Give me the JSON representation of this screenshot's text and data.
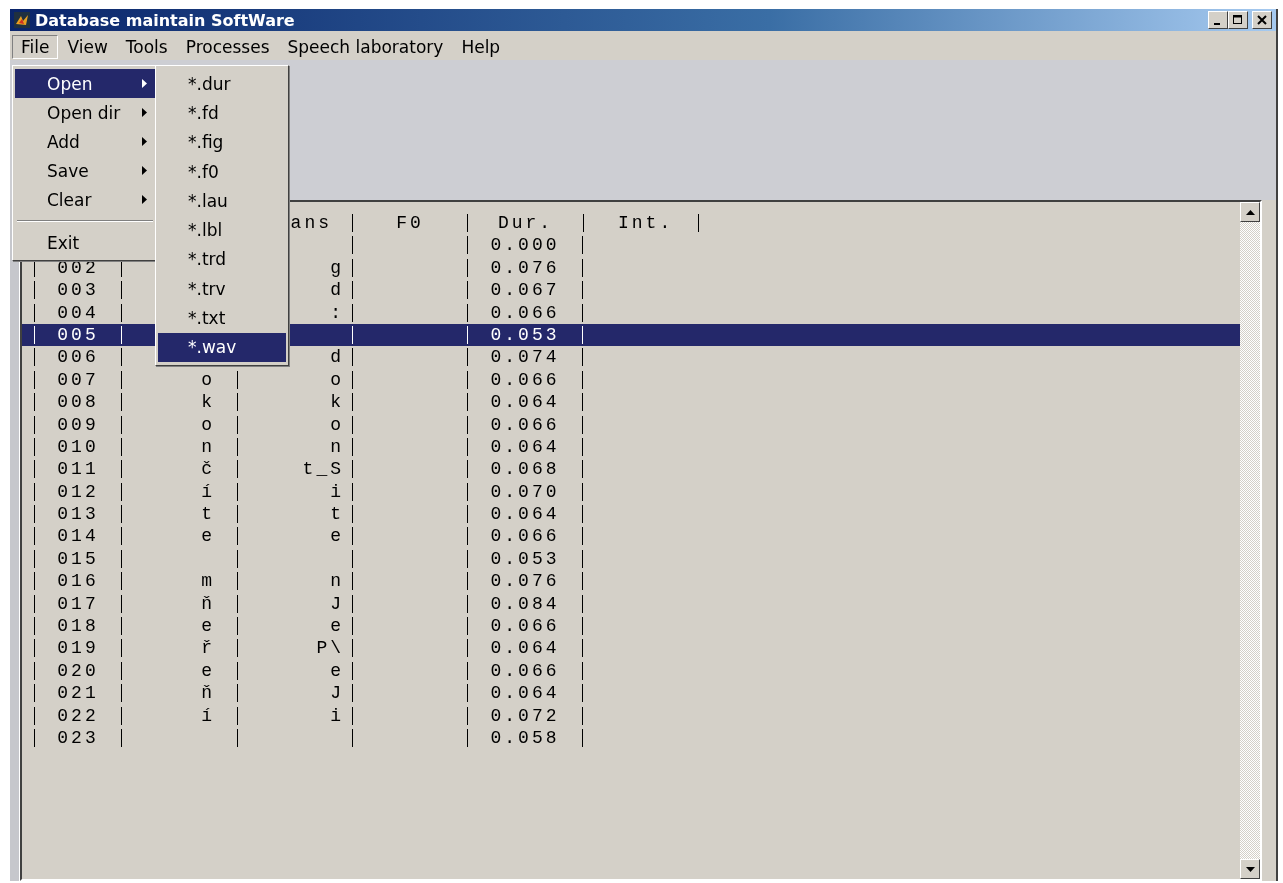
{
  "window": {
    "title": "Database maintain SoftWare"
  },
  "menu_bar": [
    {
      "label": "File",
      "selected": true
    },
    {
      "label": "View",
      "selected": false
    },
    {
      "label": "Tools",
      "selected": false
    },
    {
      "label": "Processes",
      "selected": false
    },
    {
      "label": "Speech laboratory",
      "selected": false
    },
    {
      "label": "Help",
      "selected": false
    }
  ],
  "file_menu": [
    {
      "kind": "submenu",
      "label": "Open",
      "selected": true
    },
    {
      "kind": "submenu",
      "label": "Open dir",
      "selected": false
    },
    {
      "kind": "submenu",
      "label": "Add",
      "selected": false
    },
    {
      "kind": "submenu",
      "label": "Save",
      "selected": false
    },
    {
      "kind": "submenu",
      "label": "Clear",
      "selected": false
    },
    {
      "kind": "separator"
    },
    {
      "kind": "item",
      "label": "Exit",
      "selected": false
    }
  ],
  "open_submenu": [
    {
      "label": "*.dur",
      "selected": false
    },
    {
      "label": "*.fd",
      "selected": false
    },
    {
      "label": "*.fig",
      "selected": false
    },
    {
      "label": "*.f0",
      "selected": false
    },
    {
      "label": "*.lau",
      "selected": false
    },
    {
      "label": "*.lbl",
      "selected": false
    },
    {
      "label": "*.trd",
      "selected": false
    },
    {
      "label": "*.trv",
      "selected": false
    },
    {
      "label": "*.txt",
      "selected": false
    },
    {
      "label": "*.wav",
      "selected": true
    }
  ],
  "listbox": {
    "header": {
      "column_3": "ans",
      "f0": "F0",
      "dur": "Dur.",
      "int": "Int."
    },
    "rows": [
      {
        "dur": "0.000",
        "selected": false
      },
      {
        "number": "002",
        "column_3": "g",
        "dur": "0.076",
        "selected": false
      },
      {
        "number": "003",
        "column_3": "d",
        "dur": "0.067",
        "selected": false
      },
      {
        "number": "004",
        "column_3": ":",
        "dur": "0.066",
        "selected": false
      },
      {
        "number": "005",
        "dur": "0.053",
        "selected": true
      },
      {
        "number": "006",
        "column_3": "d",
        "dur": "0.074",
        "selected": false
      },
      {
        "number": "007",
        "column_2": "o",
        "column_3": "o",
        "dur": "0.066",
        "selected": false
      },
      {
        "number": "008",
        "column_2": "k",
        "column_3": "k",
        "dur": "0.064",
        "selected": false
      },
      {
        "number": "009",
        "column_2": "o",
        "column_3": "o",
        "dur": "0.066",
        "selected": false
      },
      {
        "number": "010",
        "column_2": "n",
        "column_3": "n",
        "dur": "0.064",
        "selected": false
      },
      {
        "number": "011",
        "column_2": "č",
        "column_3": "t_S",
        "dur": "0.068",
        "selected": false
      },
      {
        "number": "012",
        "column_2": "í",
        "column_3": "i",
        "dur": "0.070",
        "selected": false
      },
      {
        "number": "013",
        "column_2": "t",
        "column_3": "t",
        "dur": "0.064",
        "selected": false
      },
      {
        "number": "014",
        "column_2": "e",
        "column_3": "e",
        "dur": "0.066",
        "selected": false
      },
      {
        "number": "015",
        "dur": "0.053",
        "selected": false
      },
      {
        "number": "016",
        "column_2": "m",
        "column_3": "n",
        "dur": "0.076",
        "selected": false
      },
      {
        "number": "017",
        "column_2": "ň",
        "column_3": "J",
        "dur": "0.084",
        "selected": false
      },
      {
        "number": "018",
        "column_2": "e",
        "column_3": "e",
        "dur": "0.066",
        "selected": false
      },
      {
        "number": "019",
        "column_2": "ř",
        "column_3": "P\\",
        "dur": "0.064",
        "selected": false
      },
      {
        "number": "020",
        "column_2": "e",
        "column_3": "e",
        "dur": "0.066",
        "selected": false
      },
      {
        "number": "021",
        "column_2": "ň",
        "column_3": "J",
        "dur": "0.064",
        "selected": false
      },
      {
        "number": "022",
        "column_2": "í",
        "column_3": "i",
        "dur": "0.072",
        "selected": false
      },
      {
        "number": "023",
        "dur": "0.058",
        "selected": false
      }
    ]
  }
}
